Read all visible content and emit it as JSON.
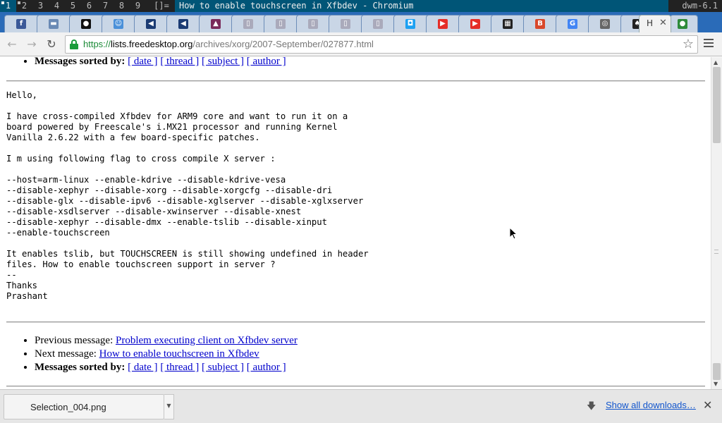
{
  "dwm": {
    "tags": [
      "1",
      "2",
      "3",
      "4",
      "5",
      "6",
      "7",
      "8",
      "9"
    ],
    "layout": "[]=",
    "window_title": "How to enable touchscreen in Xfbdev - Chromium",
    "status": "dwm-6.1"
  },
  "tabs": {
    "favicons": [
      {
        "name": "facebook-icon",
        "glyph": "f",
        "color": "#3b5998"
      },
      {
        "name": "chat-icon",
        "glyph": "▬",
        "color": "#6a8ab5"
      },
      {
        "name": "green-circle-icon",
        "glyph": "●",
        "color": "#111"
      },
      {
        "name": "contact-icon",
        "glyph": "☺",
        "color": "#4a90d9"
      },
      {
        "name": "arrow-app-icon",
        "glyph": "◀",
        "color": "#1b3b73"
      },
      {
        "name": "arrow-app-icon",
        "glyph": "◀",
        "color": "#1b3b73"
      },
      {
        "name": "logo-icon",
        "glyph": "▲",
        "color": "#7a2a5a"
      },
      {
        "name": "page-icon",
        "glyph": "▯",
        "color": "#aab"
      },
      {
        "name": "page-icon",
        "glyph": "▯",
        "color": "#aab"
      },
      {
        "name": "page-icon",
        "glyph": "▯",
        "color": "#aab"
      },
      {
        "name": "page-icon",
        "glyph": "▯",
        "color": "#aab"
      },
      {
        "name": "page-icon",
        "glyph": "▯",
        "color": "#aab"
      },
      {
        "name": "square-app-icon",
        "glyph": "◘",
        "color": "#1da1f2"
      },
      {
        "name": "youtube-icon",
        "glyph": "▶",
        "color": "#e52d27"
      },
      {
        "name": "youtube-icon",
        "glyph": "▶",
        "color": "#e52d27"
      },
      {
        "name": "dark-app-icon",
        "glyph": "▦",
        "color": "#222"
      },
      {
        "name": "b-app-icon",
        "glyph": "B",
        "color": "#d9482b"
      },
      {
        "name": "google-icon",
        "glyph": "G",
        "color": "#4285f4"
      },
      {
        "name": "compass-icon",
        "glyph": "◎",
        "color": "#666"
      },
      {
        "name": "linux-penguin-icon",
        "glyph": "♠",
        "color": "#222"
      }
    ],
    "active_title": "H",
    "last_favicon": {
      "name": "green-person-icon",
      "glyph": "●",
      "color": "#2e8b3a"
    }
  },
  "toolbar": {
    "url_scheme": "https://",
    "url_host": "lists.freedesktop.org",
    "url_path": "/archives/xorg/2007-September/027877.html"
  },
  "page": {
    "sorted_label": "Messages sorted by:",
    "sort_links": [
      "[ date ]",
      "[ thread ]",
      "[ subject ]",
      "[ author ]"
    ],
    "body": "Hello,\n\nI have cross-compiled Xfbdev for ARM9 core and want to run it on a\nboard powered by Freescale's i.MX21 processor and running Kernel\nVanilla 2.6.22 with a few board-specific patches.\n\nI m using following flag to cross compile X server :\n\n--host=arm-linux --enable-kdrive --disable-kdrive-vesa\n--disable-xephyr --disable-xorg --disable-xorgcfg --disable-dri\n--disable-glx --disable-ipv6 --disable-xglserver --disable-xglxserver\n--disable-xsdlserver --disable-xwinserver --disable-xnest\n--disable-xephyr --disable-dmx --enable-tslib --disable-xinput\n--enable-touchscreen\n\nIt enables tslib, but TOUCHSCREEN is still showing undefined in header\nfiles. How to enable touchscreen support in server ?\n--\nThanks\nPrashant",
    "prev_label": "Previous message:",
    "prev_link": "Problem executing client on Xfbdev server",
    "next_label": "Next message:",
    "next_link": "How to enable touchscreen in Xfbdev"
  },
  "downloads": {
    "file_name": "Selection_004.png",
    "show_all": "Show all downloads…"
  }
}
